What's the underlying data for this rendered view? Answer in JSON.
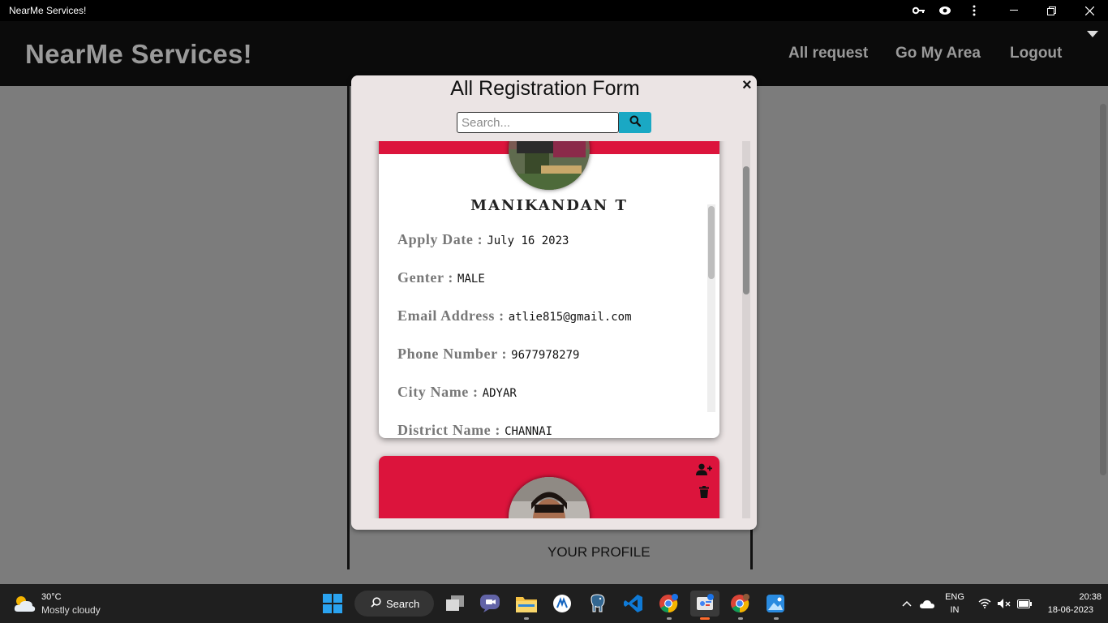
{
  "window": {
    "title": "NearMe Services!"
  },
  "navbar": {
    "brand": "NearMe Services!",
    "links": [
      "All request",
      "Go My Area",
      "Logout"
    ]
  },
  "page": {
    "profile_label": "YOUR PROFILE"
  },
  "modal": {
    "title": "All Registration Form",
    "close": "×",
    "search_placeholder": "Search...",
    "cards": [
      {
        "name": "MANIKANDAN T",
        "fields": [
          {
            "label": "Apply Date :",
            "value": "July 16 2023"
          },
          {
            "label": "Genter :",
            "value": "MALE"
          },
          {
            "label": "Email Address :",
            "value": "atlie815@gmail.com"
          },
          {
            "label": "Phone Number :",
            "value": "9677978279"
          },
          {
            "label": "City Name :",
            "value": "ADYAR"
          },
          {
            "label": "District Name :",
            "value": "CHANNAI"
          }
        ]
      }
    ]
  },
  "taskbar": {
    "weather_temp": "30°C",
    "weather_desc": "Mostly cloudy",
    "search_label": "Search",
    "language": "ENG",
    "region": "IN",
    "time": "20:38",
    "date": "18-06-2023"
  },
  "colors": {
    "accent_red": "#dc143c",
    "search_button": "#1aa8c4"
  }
}
